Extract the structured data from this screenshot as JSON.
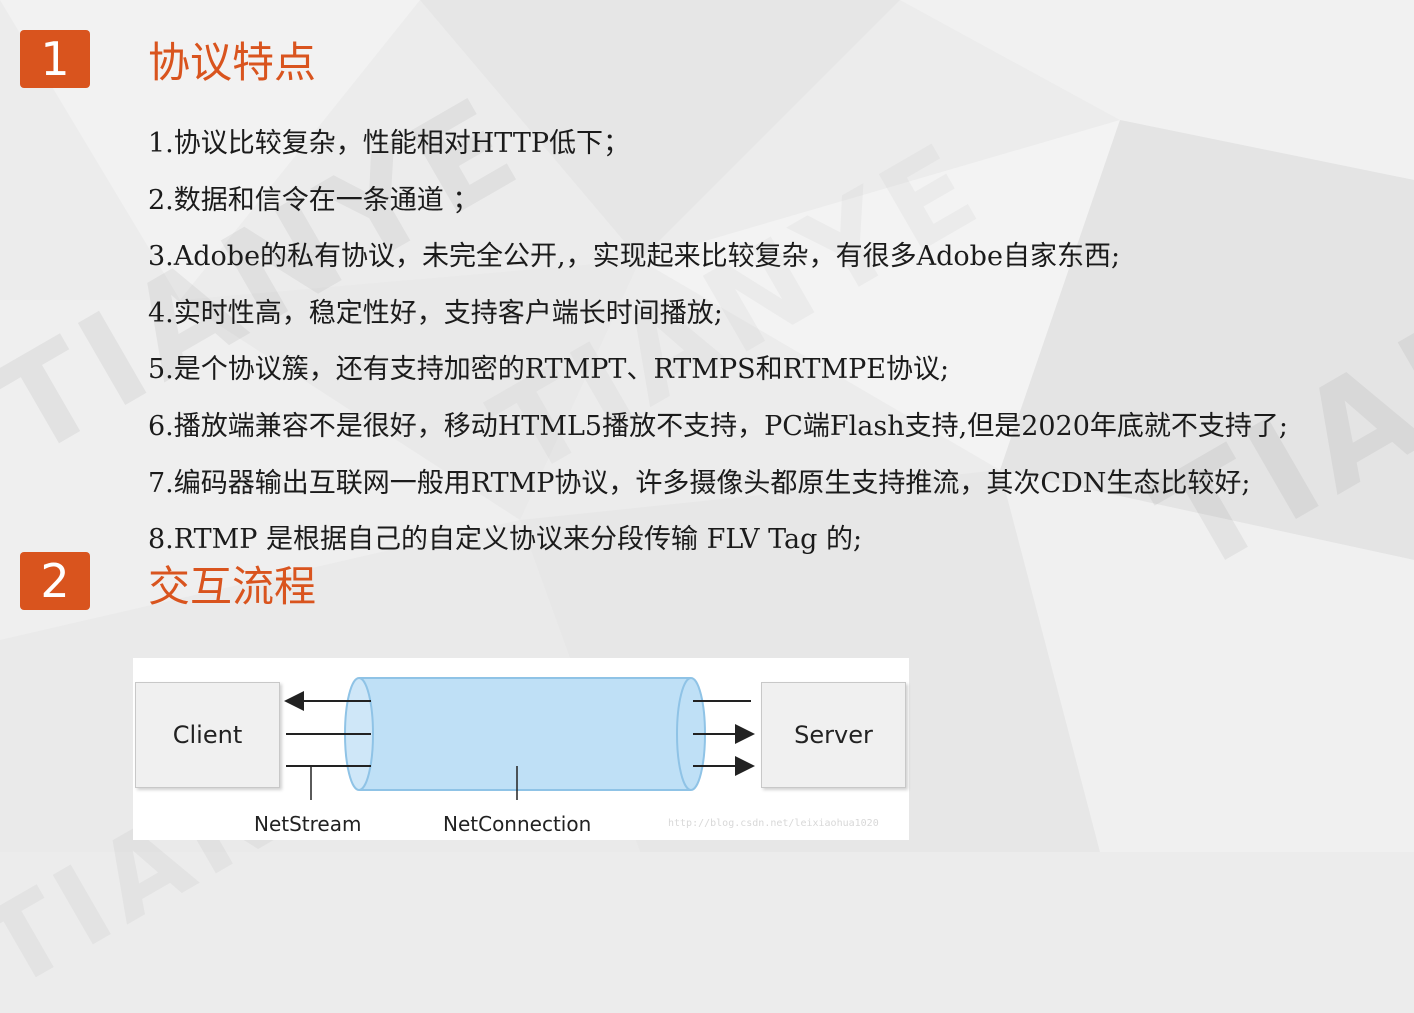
{
  "colors": {
    "accent": "#d9541e",
    "text": "#1b1b1b",
    "background": "#ececec",
    "pipe_fill": "#bfe0f6",
    "pipe_stroke": "#8fc3e6"
  },
  "watermark": "TIANYE",
  "section1": {
    "number": "1",
    "title": "协议特点",
    "items": [
      "1.协议比较复杂，性能相对HTTP低下；",
      "2.数据和信令在一条通道 ；",
      "3.Adobe的私有协议，未完全公开,，实现起来比较复杂，有很多Adobe自家东西;",
      "4.实时性高，稳定性好，支持客户端长时间播放;",
      "5.是个协议簇，还有支持加密的RTMPT、RTMPS和RTMPE协议;",
      "6.播放端兼容不是很好，移动HTML5播放不支持，PC端Flash支持,但是2020年底就不支持了;",
      "7.编码器输出互联网一般用RTMP协议，许多摄像头都原生支持推流，其次CDN生态比较好;",
      "8.RTMP 是根据自己的自定义协议来分段传输 FLV Tag 的;"
    ]
  },
  "section2": {
    "number": "2",
    "title": "交互流程"
  },
  "diagram": {
    "client_label": "Client",
    "server_label": "Server",
    "netstream_label": "NetStream",
    "netconnection_label": "NetConnection",
    "url_watermark": "http://blog.csdn.net/leixiaohua1020"
  }
}
